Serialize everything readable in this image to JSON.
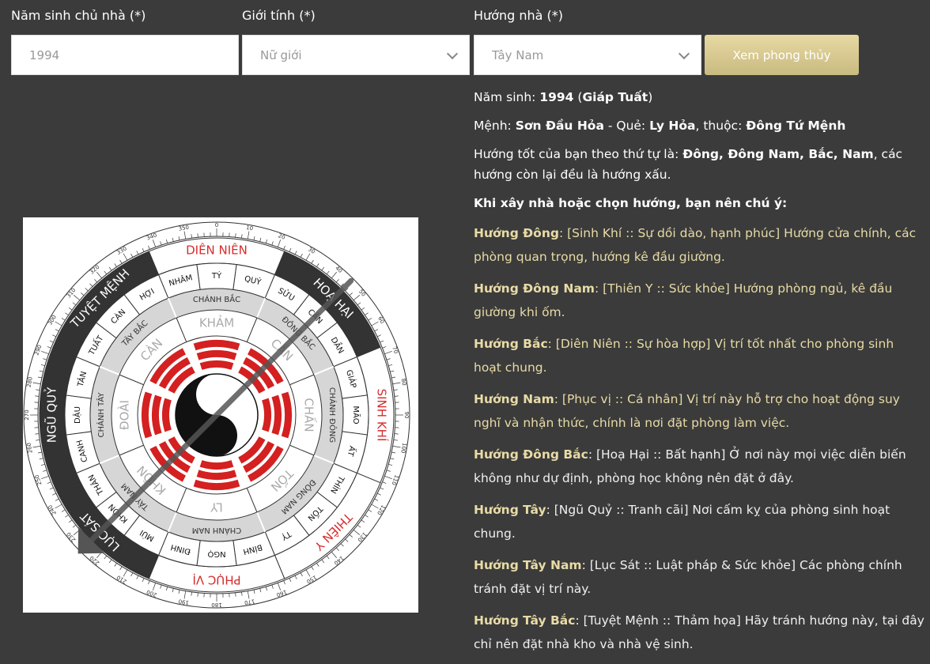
{
  "form": {
    "year_label": "Năm sinh chủ nhà (*)",
    "year_value": "1994",
    "gender_label": "Giới tính (*)",
    "gender_value": "Nữ giới",
    "direction_label": "Hướng nhà (*)",
    "direction_value": "Tây Nam",
    "submit_label": "Xem phong thủy"
  },
  "result": {
    "birth_prefix": "Năm sinh: ",
    "birth_year": "1994",
    "birth_open": " (",
    "birth_canchi": "Giáp Tuất",
    "birth_close": ")",
    "menh_prefix": "Mệnh: ",
    "menh_value": "Sơn Đầu Hỏa",
    "que_prefix": " - Quẻ: ",
    "que_value": "Ly Hỏa",
    "thuoc_prefix": ", thuộc: ",
    "thuoc_value": "Đông Tứ Mệnh",
    "good_prefix": "Hướng tốt của bạn theo thứ tự là: ",
    "good_value": "Đông, Đông Nam, Bắc, Nam",
    "good_suffix": ", các hướng còn lại đều là hướng xấu.",
    "note_heading": "Khi xây nhà hoặc chọn hướng, bạn nên chú ý:",
    "advice": [
      {
        "dir": "Hướng Đông",
        "text": ": [Sinh Khí :: Sự dồi dào, hạnh phúc] Hướng cửa chính, các phòng quan trọng, hướng kê đầu giường.",
        "good": true
      },
      {
        "dir": "Hướng Đông Nam",
        "text": ": [Thiên Y :: Sức khỏe] Hướng phòng ngủ, kê đầu giường khi ốm.",
        "good": true
      },
      {
        "dir": "Hướng Bắc",
        "text": ": [Diên Niên :: Sự hòa hợp] Vị trí tốt nhất cho phòng sinh hoạt chung.",
        "good": true
      },
      {
        "dir": "Hướng Nam",
        "text": ": [Phục vị :: Cá nhân] Vị trí này hỗ trợ cho hoạt động suy nghĩ và nhận thức, chính là nơi đặt phòng làm việc.",
        "good": true
      },
      {
        "dir": "Hướng Đông Bắc",
        "text": ": [Hoạ Hại :: Bất hạnh] Ở nơi này mọi việc diễn biến không như dự định, phòng học không nên đặt ở đây.",
        "good": false
      },
      {
        "dir": "Hướng Tây",
        "text": ": [Ngũ Quỷ :: Tranh cãi] Nơi cấm kỵ của phòng sinh hoạt chung.",
        "good": false
      },
      {
        "dir": "Hướng Tây Nam",
        "text": ": [Lục Sát :: Luật pháp & Sức khỏe] Các phòng chính tránh đặt vị trí này.",
        "good": false
      },
      {
        "dir": "Hướng Tây Bắc",
        "text": ": [Tuyệt Mệnh :: Thảm họa] Hãy tránh hướng này, tại đây chỉ nên đặt nhà kho và nhà vệ sinh.",
        "good": false
      }
    ]
  },
  "compass": {
    "stars": [
      {
        "text": "DIÊN NIÊN",
        "good": true
      },
      {
        "text": "HOẠ HẠI",
        "good": false
      },
      {
        "text": "SINH KHÍ",
        "good": true
      },
      {
        "text": "THIÊN Y",
        "good": true
      },
      {
        "text": "PHỤC VỊ",
        "good": true
      },
      {
        "text": "LỤC SÁT",
        "good": false
      },
      {
        "text": "NGŨ QUỶ",
        "good": false
      },
      {
        "text": "TUYỆT MỆNH",
        "good": false
      }
    ],
    "mountains": [
      "NHÂM",
      "TÝ",
      "QUÝ",
      "SỬU",
      "CẤN",
      "DẦN",
      "GIÁP",
      "MÃO",
      "ẤT",
      "THÌN",
      "TỐN",
      "TỴ",
      "BÍNH",
      "NGỌ",
      "ĐINH",
      "MÙI",
      "KHÔN",
      "THÂN",
      "CANH",
      "DẬU",
      "TÂN",
      "TUẤT",
      "CÀN",
      "HỢI"
    ],
    "directions": [
      "CHÁNH BẮC",
      "ĐÔNG BẮC",
      "CHÁNH ĐÔNG",
      "ĐÔNG NAM",
      "CHÁNH NAM",
      "TÂY NAM",
      "CHÁNH TÂY",
      "TÂY BẮC"
    ],
    "trigrams": [
      "KHẢM",
      "CẤN",
      "CHẤN",
      "TỐN",
      "LY",
      "KHÔN",
      "ĐOÀI",
      "CÀN"
    ],
    "degree_labels": [
      "340",
      "350",
      "0",
      "10",
      "20",
      "30",
      "40",
      "50",
      "60",
      "70",
      "80",
      "90",
      "100",
      "110",
      "120",
      "130",
      "140",
      "150",
      "160",
      "170",
      "180",
      "190",
      "200",
      "210",
      "220",
      "230",
      "240",
      "250",
      "260",
      "270",
      "280",
      "290",
      "300",
      "310",
      "320",
      "330"
    ]
  }
}
